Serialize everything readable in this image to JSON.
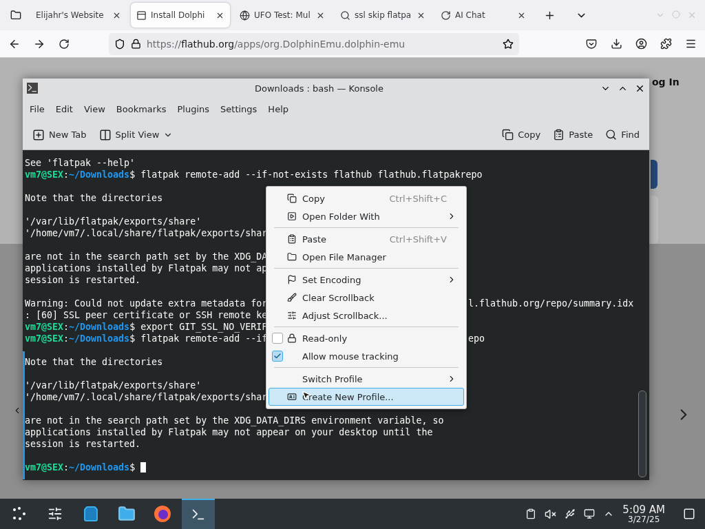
{
  "browser": {
    "tabs": [
      {
        "title": "Elijahr's Website",
        "selected": false
      },
      {
        "title": "Install Dolphi",
        "selected": true
      },
      {
        "title": "UFO Test: Mul",
        "selected": false
      },
      {
        "title": "ssl skip flatpa",
        "selected": false
      },
      {
        "title": "AI Chat",
        "selected": false
      }
    ],
    "url": {
      "scheme": "https://",
      "domain": "flathub.org",
      "path": "/apps/org.DolphinEmu.dolphin-emu"
    },
    "page": {
      "login": "og In"
    }
  },
  "konsole": {
    "title": "Downloads : bash — Konsole",
    "menu": [
      "File",
      "Edit",
      "View",
      "Bookmarks",
      "Plugins",
      "Settings",
      "Help"
    ],
    "toolbar_left": [
      "New Tab",
      "Split View"
    ],
    "toolbar_right": [
      "Copy",
      "Paste",
      "Find"
    ],
    "lines": [
      {
        "kind": "text",
        "text": "See 'flatpak --help'"
      },
      {
        "kind": "prompt",
        "prompt": {
          "user": "vm7@SEX",
          "sep": ":",
          "path": "~/Downloads",
          "sign": "$"
        },
        "text": "flatpak remote-add --if-not-exists flathub flathub.flatpakrepo"
      },
      {
        "kind": "blank"
      },
      {
        "kind": "text",
        "text": "Note that the directories"
      },
      {
        "kind": "blank"
      },
      {
        "kind": "text",
        "text": "'/var/lib/flatpak/exports/share'"
      },
      {
        "kind": "text",
        "text": "'/home/vm7/.local/share/flatpak/exports/shar"
      },
      {
        "kind": "blank"
      },
      {
        "kind": "text",
        "text": "are not in the search path set by the XDG_DA"
      },
      {
        "kind": "text",
        "text": "applications installed by Flatpak may not ap"
      },
      {
        "kind": "text",
        "text": "session is restarted."
      },
      {
        "kind": "blank"
      },
      {
        "kind": "text",
        "text": "Warning: Could not update extra metadata for",
        "after": "l.flathub.org/repo/summary.idx"
      },
      {
        "kind": "text",
        "text": ": [60] SSL peer certificate or SSH remote ke"
      },
      {
        "kind": "prompt",
        "prompt": {
          "user": "vm7@SEX",
          "sep": ":",
          "path": "~/Downloads",
          "sign": "$"
        },
        "text": "export GIT_SSL_NO_VERIF"
      },
      {
        "kind": "prompt",
        "prompt": {
          "user": "vm7@SEX",
          "sep": ":",
          "path": "~/Downloads",
          "sign": "$"
        },
        "text": "flatpak remote-add --if",
        "after": "epo"
      },
      {
        "kind": "blank"
      },
      {
        "kind": "text",
        "text": "Note that the directories"
      },
      {
        "kind": "blank"
      },
      {
        "kind": "text",
        "text": "'/var/lib/flatpak/exports/share'"
      },
      {
        "kind": "text",
        "text": "'/home/vm7/.local/share/flatpak/exports/shar"
      },
      {
        "kind": "blank"
      },
      {
        "kind": "text",
        "text": "are not in the search path set by the XDG_DATA_DIRS environment variable, so"
      },
      {
        "kind": "text",
        "text": "applications installed by Flatpak may not appear on your desktop until the"
      },
      {
        "kind": "text",
        "text": "session is restarted."
      },
      {
        "kind": "blank"
      },
      {
        "kind": "prompt",
        "prompt": {
          "user": "vm7@SEX",
          "sep": ":",
          "path": "~/Downloads",
          "sign": "$"
        },
        "cursor": true
      }
    ],
    "context_menu": [
      [
        {
          "kind": "action",
          "label": "Copy",
          "shortcut": "Ctrl+Shift+C",
          "submenu": false,
          "selected": false
        },
        {
          "kind": "action",
          "label": "Open Folder With",
          "submenu": true,
          "selected": false
        }
      ],
      [
        {
          "kind": "action",
          "label": "Paste",
          "shortcut": "Ctrl+Shift+V",
          "submenu": false,
          "selected": false
        },
        {
          "kind": "action",
          "label": "Open File Manager",
          "submenu": false,
          "selected": false
        }
      ],
      [
        {
          "kind": "action",
          "label": "Set Encoding",
          "submenu": true,
          "selected": false
        },
        {
          "kind": "action",
          "label": "Clear Scrollback",
          "submenu": false,
          "selected": false
        },
        {
          "kind": "action",
          "label": "Adjust Scrollback...",
          "submenu": false,
          "selected": false
        }
      ],
      [
        {
          "kind": "check",
          "label": "Read-only",
          "checked": false,
          "submenu": false,
          "selected": false
        },
        {
          "kind": "check",
          "label": "Allow mouse tracking",
          "checked": true,
          "submenu": false,
          "selected": false
        }
      ],
      [
        {
          "kind": "action",
          "label": "Switch Profile",
          "submenu": true,
          "selected": false
        },
        {
          "kind": "action",
          "label": "Create New Profile...",
          "submenu": false,
          "selected": true
        }
      ]
    ]
  },
  "taskbar": {
    "time": "5:09 AM",
    "date": "3/27/25"
  }
}
